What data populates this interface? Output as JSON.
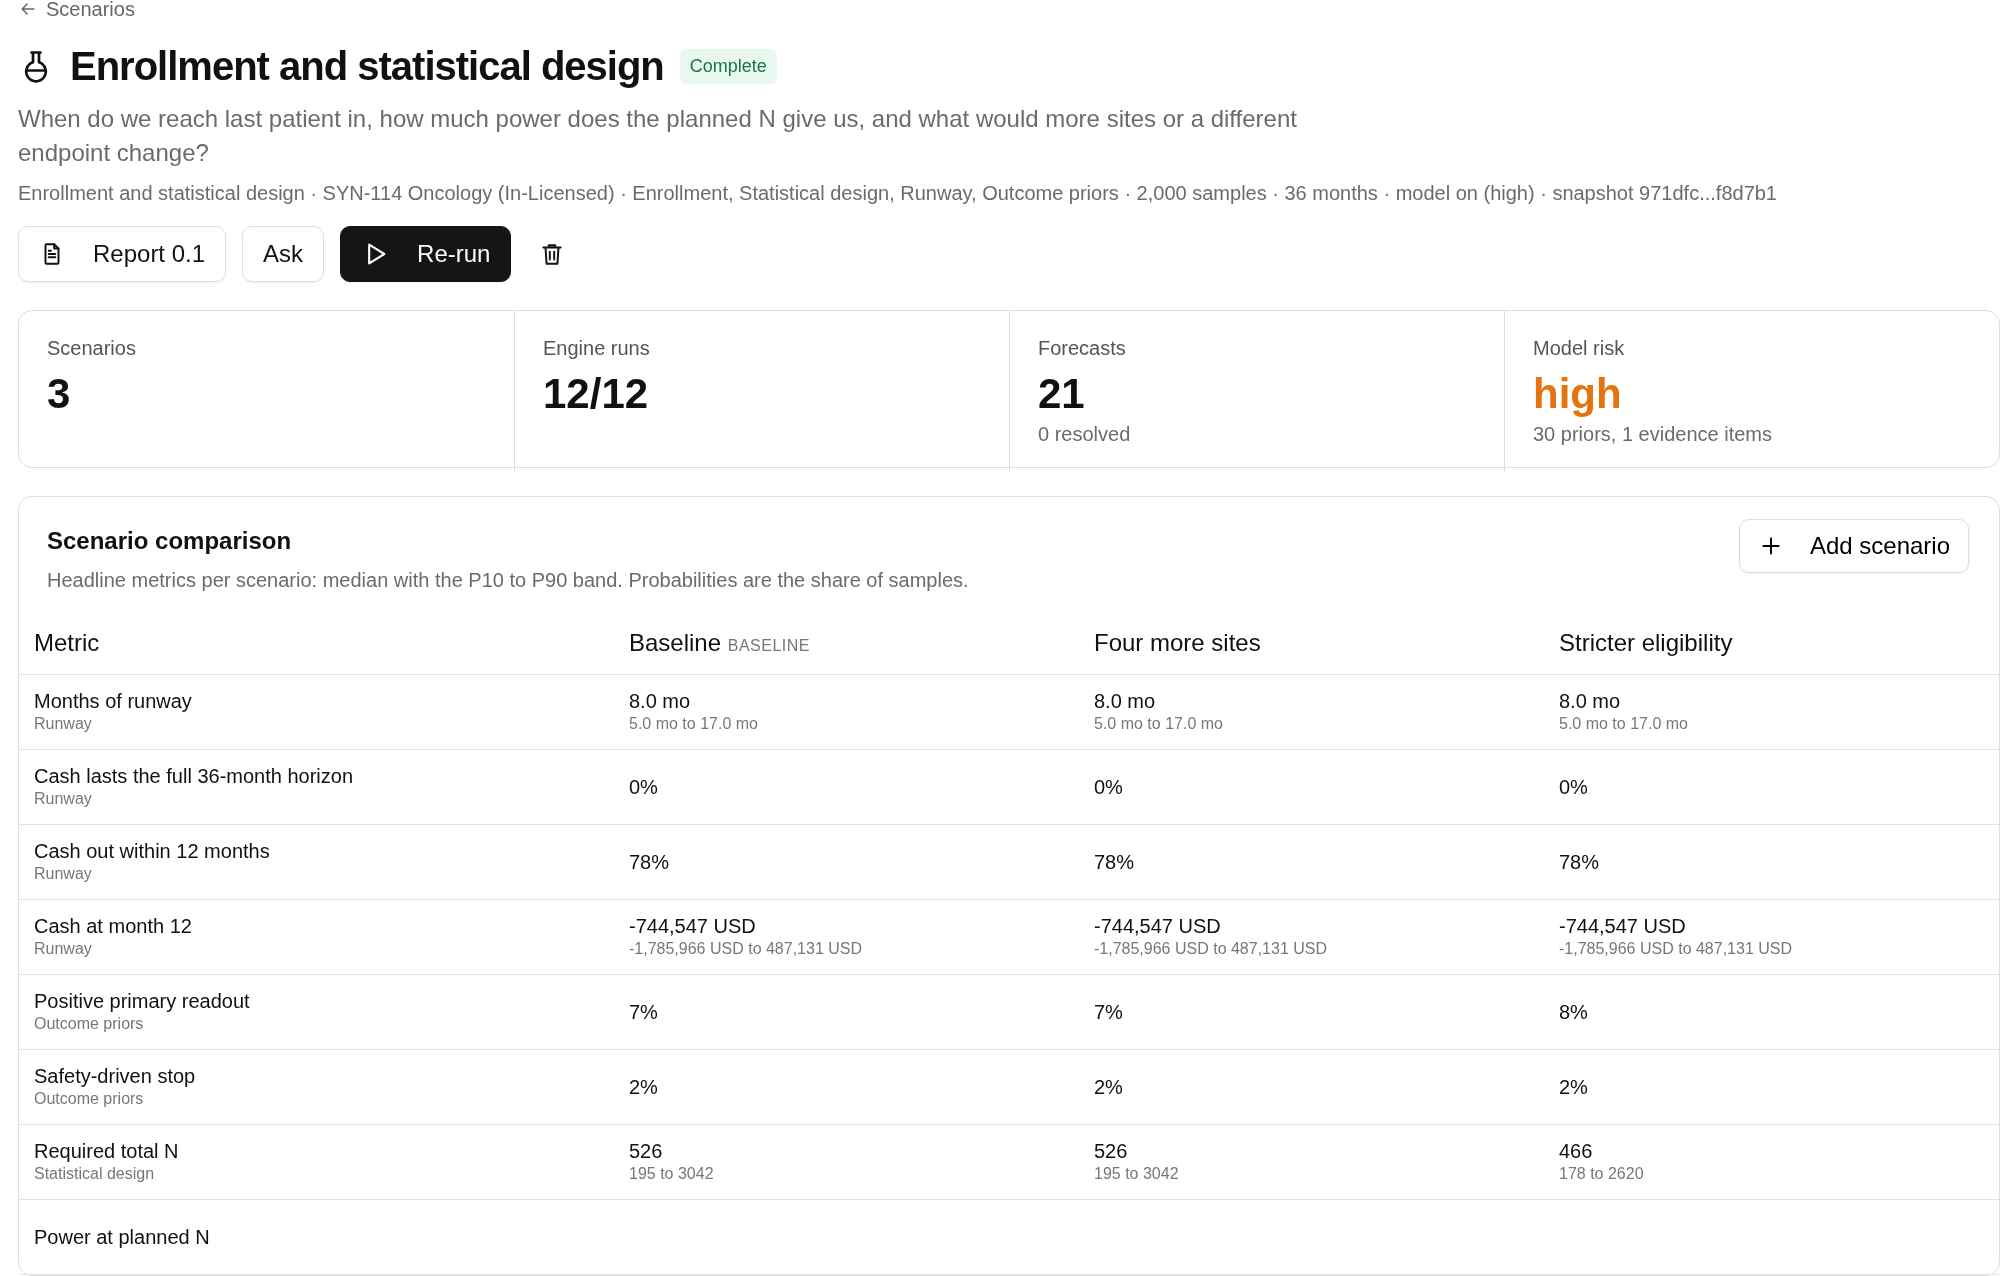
{
  "back_link": "Scenarios",
  "header": {
    "title": "Enrollment and statistical design",
    "status": "Complete",
    "description": "When do we reach last patient in, how much power does the planned N give us, and what would more sites or a different endpoint change?",
    "meta": "Enrollment and statistical design · SYN-114 Oncology (In-Licensed) · Enrollment, Statistical design, Runway, Outcome priors · 2,000 samples · 36 months · model on (high) · snapshot 971dfc...f8d7b1"
  },
  "actions": [
    {
      "label": "Report 0.1",
      "kind": "report"
    },
    {
      "label": "Ask",
      "kind": "plain"
    },
    {
      "label": "Re-run",
      "kind": "primary"
    },
    {
      "kind": "delete"
    }
  ],
  "stats": [
    {
      "label": "Scenarios",
      "value": "3",
      "alert": false
    },
    {
      "label": "Engine runs",
      "value": "12/12",
      "alert": false
    },
    {
      "label": "Forecasts",
      "value": "21",
      "note": "0 resolved",
      "alert": false
    },
    {
      "label": "Model risk",
      "value": "high",
      "note": "30 priors, 1 evidence items",
      "alert": true
    }
  ],
  "comparison": {
    "title": "Scenario comparison",
    "subtitle": "Headline metrics per scenario: median with the P10 to P90 band. Probabilities are the share of samples.",
    "add_button": "Add scenario",
    "columns": [
      {
        "label": "Metric"
      },
      {
        "label": "Baseline",
        "tag": "BASELINE"
      },
      {
        "label": "Four more sites"
      },
      {
        "label": "Stricter eligibility"
      }
    ],
    "rows": [
      {
        "metric": "Months of runway",
        "group": "Runway",
        "values": [
          {
            "value": "8.0 mo",
            "band": "5.0 mo to 17.0 mo"
          },
          {
            "value": "8.0 mo",
            "band": "5.0 mo to 17.0 mo"
          },
          {
            "value": "8.0 mo",
            "band": "5.0 mo to 17.0 mo"
          }
        ]
      },
      {
        "metric": "Cash lasts the full 36-month horizon",
        "group": "Runway",
        "values": [
          {
            "value": "0%"
          },
          {
            "value": "0%"
          },
          {
            "value": "0%"
          }
        ]
      },
      {
        "metric": "Cash out within 12 months",
        "group": "Runway",
        "values": [
          {
            "value": "78%"
          },
          {
            "value": "78%"
          },
          {
            "value": "78%"
          }
        ]
      },
      {
        "metric": "Cash at month 12",
        "group": "Runway",
        "values": [
          {
            "value": "-744,547 USD",
            "band": "-1,785,966 USD to 487,131 USD"
          },
          {
            "value": "-744,547 USD",
            "band": "-1,785,966 USD to 487,131 USD"
          },
          {
            "value": "-744,547 USD",
            "band": "-1,785,966 USD to 487,131 USD"
          }
        ]
      },
      {
        "metric": "Positive primary readout",
        "group": "Outcome priors",
        "values": [
          {
            "value": "7%"
          },
          {
            "value": "7%"
          },
          {
            "value": "8%"
          }
        ]
      },
      {
        "metric": "Safety-driven stop",
        "group": "Outcome priors",
        "values": [
          {
            "value": "2%"
          },
          {
            "value": "2%"
          },
          {
            "value": "2%"
          }
        ]
      },
      {
        "metric": "Required total N",
        "group": "Statistical design",
        "values": [
          {
            "value": "526",
            "band": "195 to 3042"
          },
          {
            "value": "526",
            "band": "195 to 3042"
          },
          {
            "value": "466",
            "band": "178 to 2620"
          }
        ]
      },
      {
        "metric": "Power at planned N"
      }
    ]
  }
}
